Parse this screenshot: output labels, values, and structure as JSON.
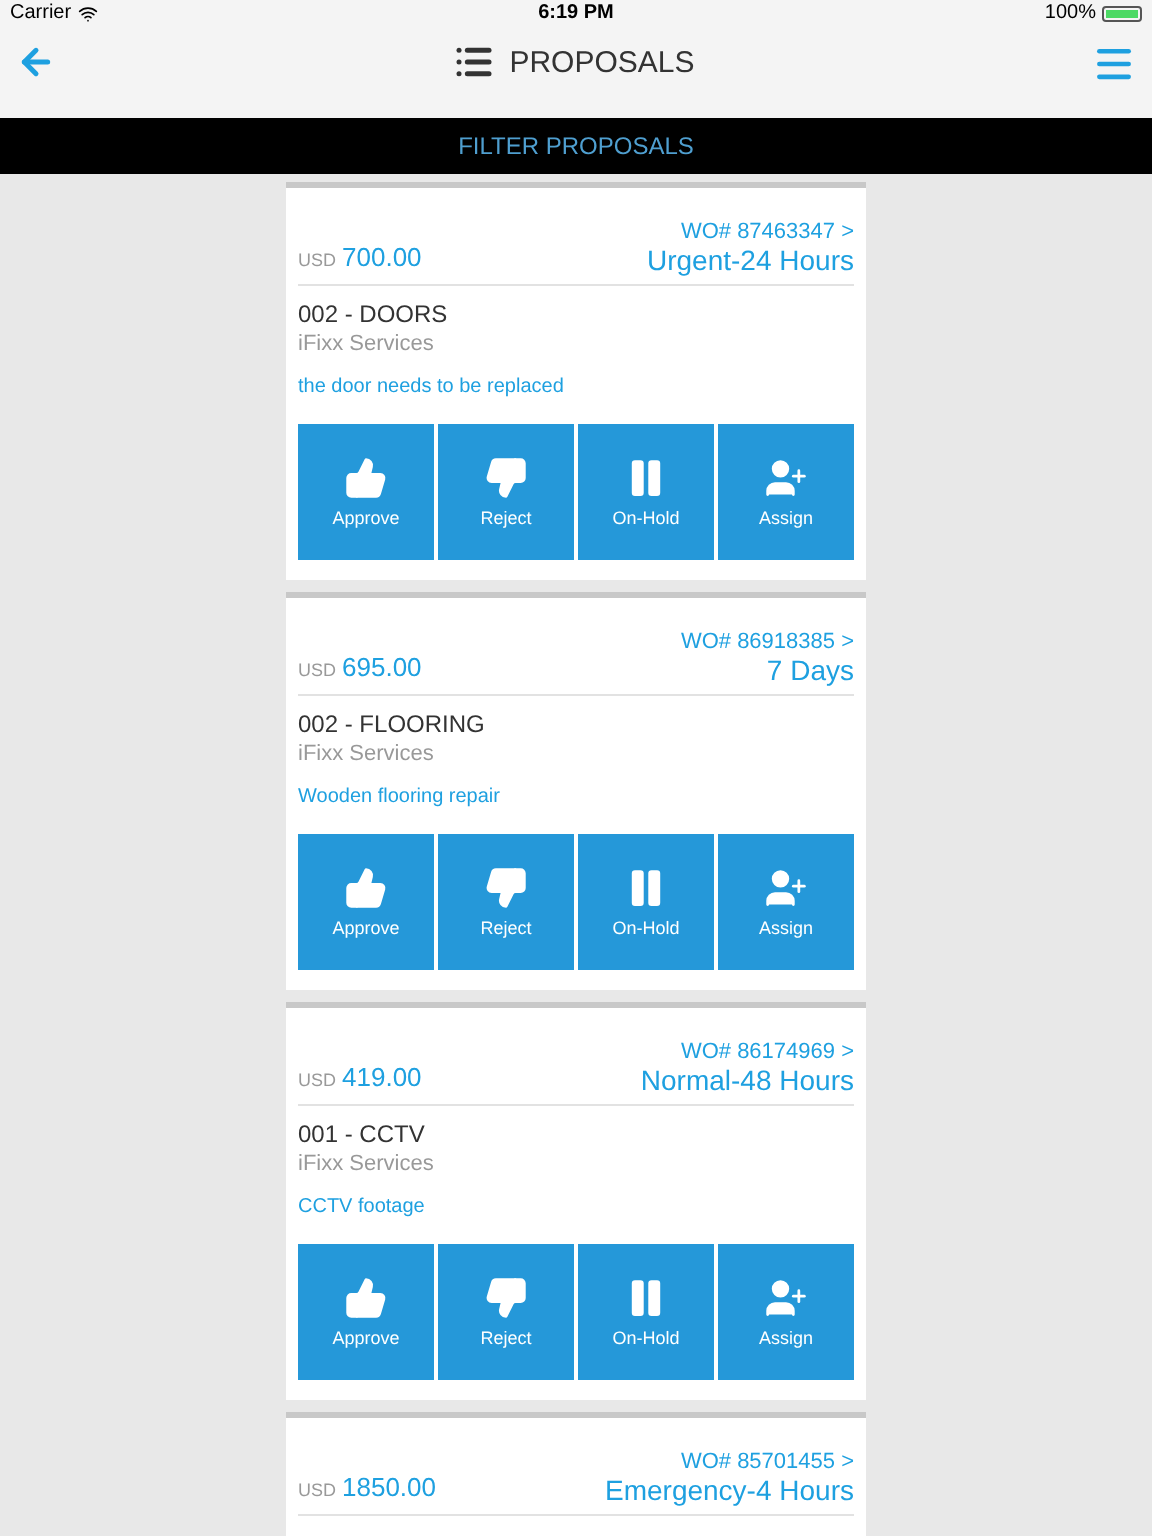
{
  "status_bar": {
    "carrier": "Carrier",
    "time": "6:19 PM",
    "battery": "100%"
  },
  "nav": {
    "title": "PROPOSALS"
  },
  "filter": {
    "label": "FILTER PROPOSALS"
  },
  "proposals": [
    {
      "currency": "USD",
      "amount": "700.00",
      "wo": "WO# 87463347 >",
      "priority": "Urgent-24 Hours",
      "title": "002 - DOORS",
      "company": "iFixx Services",
      "description": "the door needs to be replaced",
      "actions": [
        {
          "kind": "approve",
          "label": "Approve"
        },
        {
          "kind": "reject",
          "label": "Reject"
        },
        {
          "kind": "hold",
          "label": "On-Hold"
        },
        {
          "kind": "assign",
          "label": "Assign"
        }
      ]
    },
    {
      "currency": "USD",
      "amount": "695.00",
      "wo": "WO# 86918385 >",
      "priority": "7 Days",
      "title": "002 - FLOORING",
      "company": "iFixx Services",
      "description": "Wooden flooring repair",
      "actions": [
        {
          "kind": "approve",
          "label": "Approve"
        },
        {
          "kind": "reject",
          "label": "Reject"
        },
        {
          "kind": "hold",
          "label": "On-Hold"
        },
        {
          "kind": "assign",
          "label": "Assign"
        }
      ]
    },
    {
      "currency": "USD",
      "amount": "419.00",
      "wo": "WO# 86174969 >",
      "priority": "Normal-48 Hours",
      "title": "001 - CCTV",
      "company": "iFixx Services",
      "description": "CCTV footage",
      "actions": [
        {
          "kind": "approve",
          "label": "Approve"
        },
        {
          "kind": "reject",
          "label": "Reject"
        },
        {
          "kind": "hold",
          "label": "On-Hold"
        },
        {
          "kind": "assign",
          "label": "Assign"
        }
      ]
    },
    {
      "currency": "USD",
      "amount": "1850.00",
      "wo": "WO# 85701455 >",
      "priority": "Emergency-4 Hours"
    }
  ]
}
